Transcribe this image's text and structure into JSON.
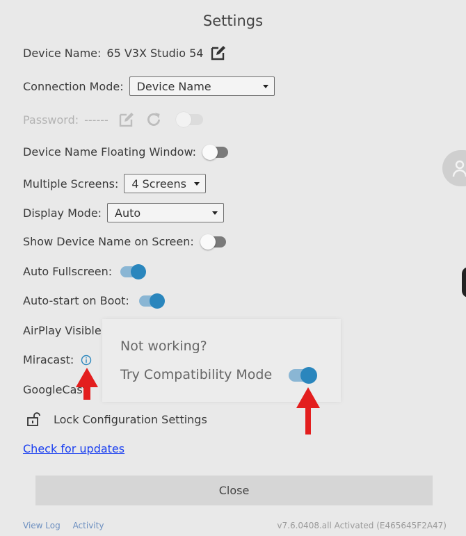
{
  "title": "Settings",
  "device_name": {
    "label": "Device Name:",
    "value": "65 V3X Studio 54"
  },
  "connection_mode": {
    "label": "Connection Mode:",
    "selected": "Device Name"
  },
  "password": {
    "label": "Password:",
    "value": "------"
  },
  "floating_window": {
    "label": "Device Name Floating Window:",
    "on": false
  },
  "multiple_screens": {
    "label": "Multiple Screens:",
    "selected": "4 Screens"
  },
  "display_mode": {
    "label": "Display Mode:",
    "selected": "Auto"
  },
  "show_device_name": {
    "label": "Show Device Name on Screen:",
    "on": false
  },
  "auto_fullscreen": {
    "label": "Auto Fullscreen:",
    "on": true
  },
  "auto_start": {
    "label": "Auto-start on Boot:",
    "on": true
  },
  "airplay": {
    "label": "AirPlay Visible"
  },
  "miracast": {
    "label": "Miracast:"
  },
  "googlecast": {
    "label": "GoogleCast"
  },
  "lock_config": {
    "label": "Lock Configuration Settings"
  },
  "check_updates": "Check for updates",
  "popup": {
    "line1": "Not working?",
    "line2": "Try Compatibility Mode",
    "on": true
  },
  "close_label": "Close",
  "footer": {
    "view_log": "View Log",
    "activity": "Activity",
    "version": "v7.6.0408.all Activated (E465645F2A47)"
  },
  "colors": {
    "accent": "#2a86bd",
    "arrow": "#e31e1e",
    "link": "#1a3ff0"
  },
  "icons": [
    "edit-icon",
    "refresh-icon",
    "info-icon",
    "unlock-icon",
    "user-icon",
    "arrow-up-icon"
  ]
}
